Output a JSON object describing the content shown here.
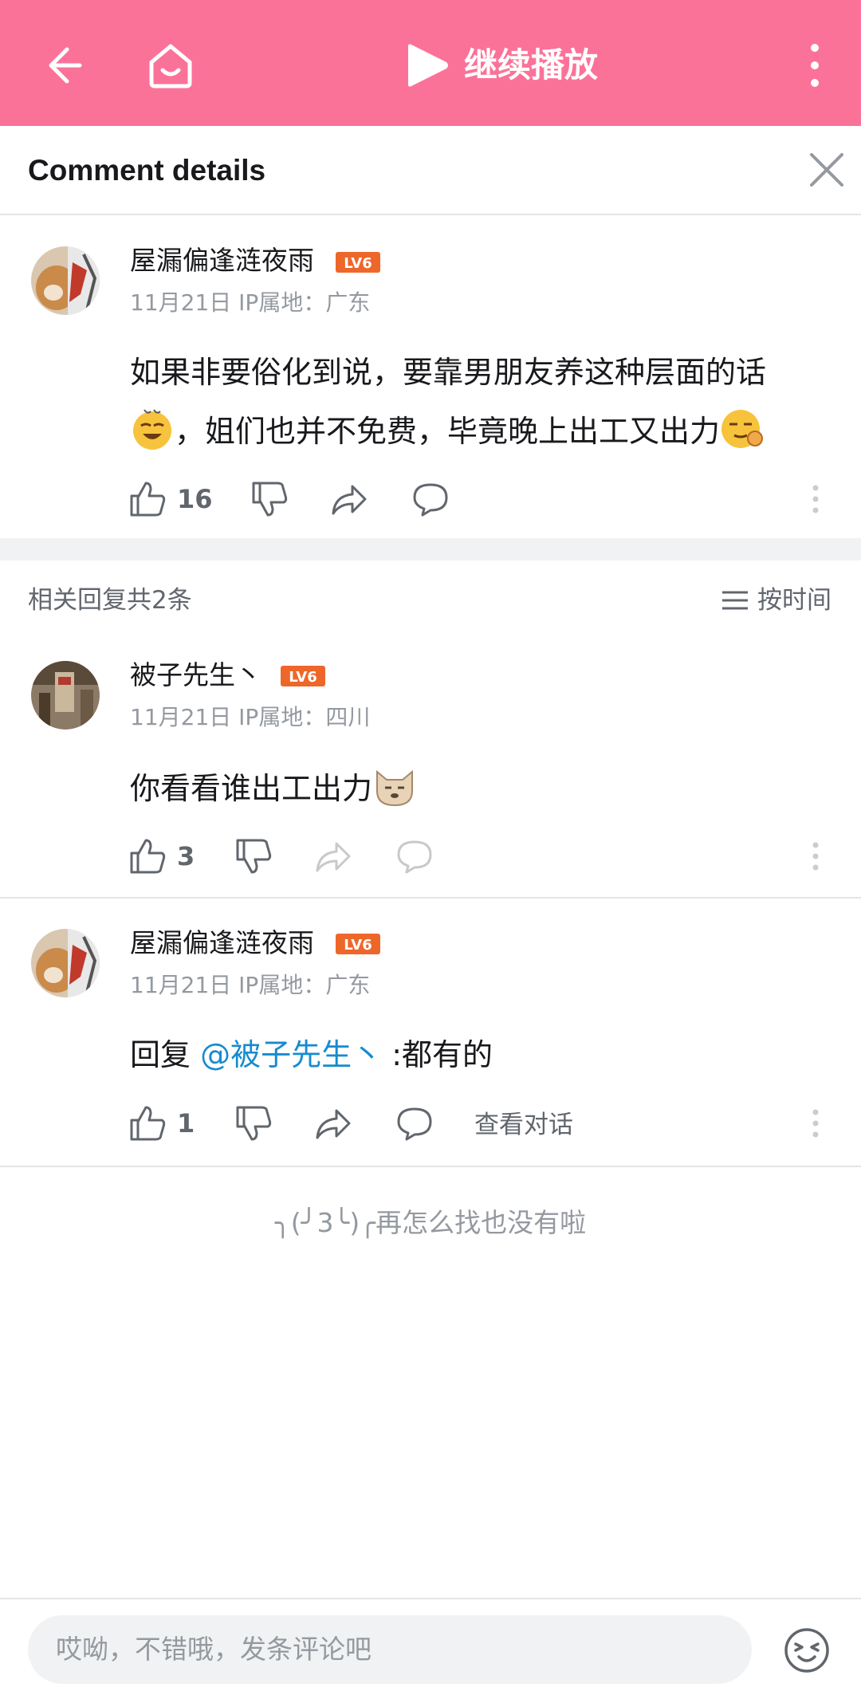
{
  "topbar": {
    "title": "继续播放",
    "accent_color": "#fb7299"
  },
  "detail": {
    "title": "Comment details"
  },
  "main_comment": {
    "username": "屋漏偏逢涟夜雨",
    "level": "LV6",
    "date": "11月21日",
    "ip": "IP属地：广东",
    "text_line1": "如果非要俗化到说，要靠男朋友养这种层面的话",
    "text_line2": "，姐们也并不免费，毕竟晚上出工又出力",
    "likes": "16"
  },
  "replies_header": {
    "count_label": "相关回复共2条",
    "sort_label": "按时间"
  },
  "replies": [
    {
      "username": "被子先生丶",
      "level": "LV6",
      "date": "11月21日",
      "ip": "IP属地：四川",
      "text": "你看看谁出工出力",
      "likes": "3"
    },
    {
      "username": "屋漏偏逢涟夜雨",
      "level": "LV6",
      "date": "11月21日",
      "ip": "IP属地：广东",
      "reply_prefix": "回复 ",
      "mention": "@被子先生丶",
      "text": " :都有的",
      "likes": "1",
      "view_conversation": "查看对话"
    }
  ],
  "end_message": "╮(╯3╰)╭再怎么找也没有啦",
  "input": {
    "placeholder": "哎呦，不错哦，发条评论吧"
  },
  "icons": [
    "back-arrow-icon",
    "home-icon",
    "play-icon",
    "more-vertical-icon",
    "close-icon",
    "like-icon",
    "dislike-icon",
    "share-icon",
    "comment-icon",
    "sort-icon",
    "emoji-icon"
  ]
}
